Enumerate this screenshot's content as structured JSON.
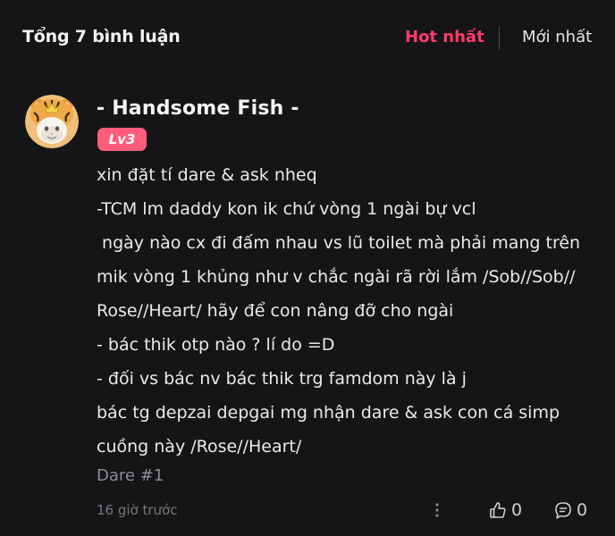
{
  "header": {
    "total_label": "Tổng 7 bình luận",
    "sort_hot": "Hot nhất",
    "sort_new": "Mới nhất"
  },
  "colors": {
    "background": "#151517",
    "accent": "#ff3b6b",
    "badge": "#ff5c7c",
    "muted": "#8d8d92"
  },
  "comment": {
    "username": "- Handsome Fish -",
    "level": "Lv3",
    "avatar_icon": "tiger-hat-cat-avatar",
    "lines": [
      "xin đặt tí dare & ask nheq",
      "-TCM lm daddy kon ik chứ vòng 1 ngài bự vcl",
      " ngày nào cx đi đấm nhau vs lũ toilet mà phải mang trên",
      "mik vòng 1 khủng như v chắc ngài rã rời lắm /Sob//Sob//",
      "Rose//Heart/ hãy để con nâng đỡ cho ngài",
      "- bác thik otp nào ? lí do =D",
      "- đối vs bác nv bác thik trg famdom này là j",
      "bác tg depzai depgai mg nhận dare & ask con cá simp",
      "cuồng này /Rose//Heart/"
    ],
    "tag": "Dare #1",
    "timestamp": "16 giờ trước",
    "more_icon": "more-vertical-icon",
    "like_icon": "thumbs-up-icon",
    "like_count": "0",
    "comment_icon": "chat-bubble-icon",
    "reply_count": "0"
  }
}
